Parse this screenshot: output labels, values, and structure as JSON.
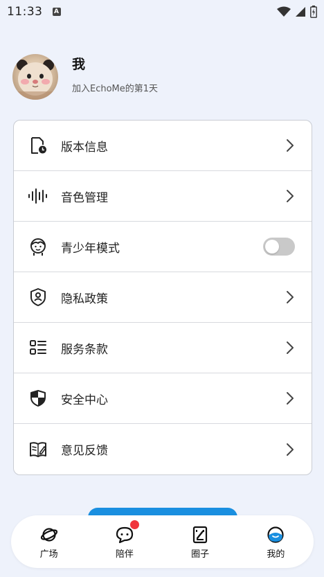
{
  "status_bar": {
    "time": "11:33",
    "notification_letter": "A"
  },
  "profile": {
    "name": "我",
    "subtitle": "加入EchoMe的第1天"
  },
  "menu": {
    "items": [
      {
        "label": "版本信息",
        "icon": "document-clock-icon",
        "control": "chevron"
      },
      {
        "label": "音色管理",
        "icon": "sound-wave-icon",
        "control": "chevron"
      },
      {
        "label": "青少年模式",
        "icon": "child-face-icon",
        "control": "toggle",
        "toggle_on": false
      },
      {
        "label": "隐私政策",
        "icon": "shield-user-icon",
        "control": "chevron"
      },
      {
        "label": "服务条款",
        "icon": "list-icon",
        "control": "chevron"
      },
      {
        "label": "安全中心",
        "icon": "shield-split-icon",
        "control": "chevron"
      },
      {
        "label": "意见反馈",
        "icon": "book-pen-icon",
        "control": "chevron"
      }
    ]
  },
  "tabbar": {
    "tabs": [
      {
        "label": "广场",
        "icon": "planet-icon"
      },
      {
        "label": "陪伴",
        "icon": "chat-bubble-icon",
        "badge": true
      },
      {
        "label": "圈子",
        "icon": "notebook-icon"
      },
      {
        "label": "我的",
        "icon": "profile-face-icon",
        "active": true
      }
    ]
  },
  "colors": {
    "background": "#eef2fb",
    "accent_blue": "#1a8fe0",
    "badge_red": "#f0353d",
    "toggle_off": "#c9c9c9"
  }
}
